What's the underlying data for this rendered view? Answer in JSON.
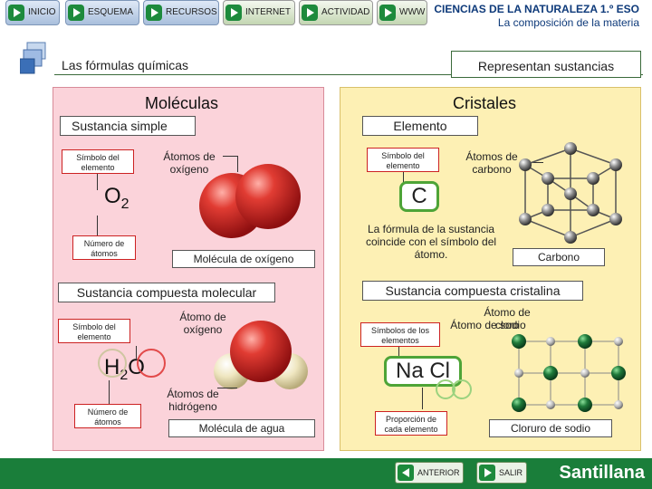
{
  "nav": {
    "items": [
      {
        "label": "INICIO",
        "icon": "play-arrow-icon"
      },
      {
        "label": "ESQUEMA",
        "icon": "play-arrow-icon"
      },
      {
        "label": "RECURSOS",
        "icon": "play-arrow-icon"
      },
      {
        "label": "INTERNET",
        "icon": "play-arrow-icon"
      },
      {
        "label": "ACTIVIDAD",
        "icon": "play-arrow-icon"
      },
      {
        "label": "WWW",
        "icon": "play-arrow-icon"
      }
    ]
  },
  "header": {
    "title": "CIENCIAS DE LA NATURALEZA 1.º ESO",
    "subtitle": "La composición de la materia"
  },
  "section": {
    "title": "Las fórmulas químicas",
    "tag": "Representan sustancias"
  },
  "molecules": {
    "title": "Moléculas",
    "simple": {
      "heading": "Sustancia simple",
      "symbol_label": "Símbolo del elemento",
      "atoms_label": "Átomos de oxígeno",
      "formula_main": "O",
      "formula_sub": "2",
      "count_label": "Número de átomos",
      "caption": "Molécula de oxígeno"
    },
    "compound": {
      "heading": "Sustancia compuesta molecular",
      "symbol_label": "Símbolo del elemento",
      "atom_label": "Átomo de oxígeno",
      "formula_h": "H",
      "formula_sub": "2",
      "formula_o": "O",
      "count_label": "Número de átomos",
      "hydrogen_label": "Átomos de hidrógeno",
      "caption": "Molécula de agua"
    }
  },
  "crystals": {
    "title": "Cristales",
    "element": {
      "heading": "Elemento",
      "symbol_label": "Símbolo del elemento",
      "atoms_label": "Átomos de carbono",
      "formula": "C",
      "note": "La fórmula de la sustancia coincide con el símbolo del átomo.",
      "caption": "Carbono"
    },
    "compound": {
      "heading": "Sustancia compuesta cristalina",
      "symbols_label": "Símbolos de los elementos",
      "chlorine_label": "Átomo de cloro",
      "sodium_label": "Átomo de sodio",
      "formula": "Na Cl",
      "ratio_label": "Proporción de cada elemento",
      "caption": "Cloruro de sodio"
    }
  },
  "footer": {
    "prev_label": "ANTERIOR",
    "exit_label": "SALIR",
    "logo": "Santillana"
  },
  "colors": {
    "pink_panel": "#fbd3da",
    "yellow_panel": "#fdf0b4",
    "accent_green": "#1d8a3c",
    "oxygen_red": "#d8262b",
    "hydrogen_cream": "#efe6c0",
    "chlorine_green": "#1f7a3a",
    "sodium_grey": "#b8b8b8"
  }
}
